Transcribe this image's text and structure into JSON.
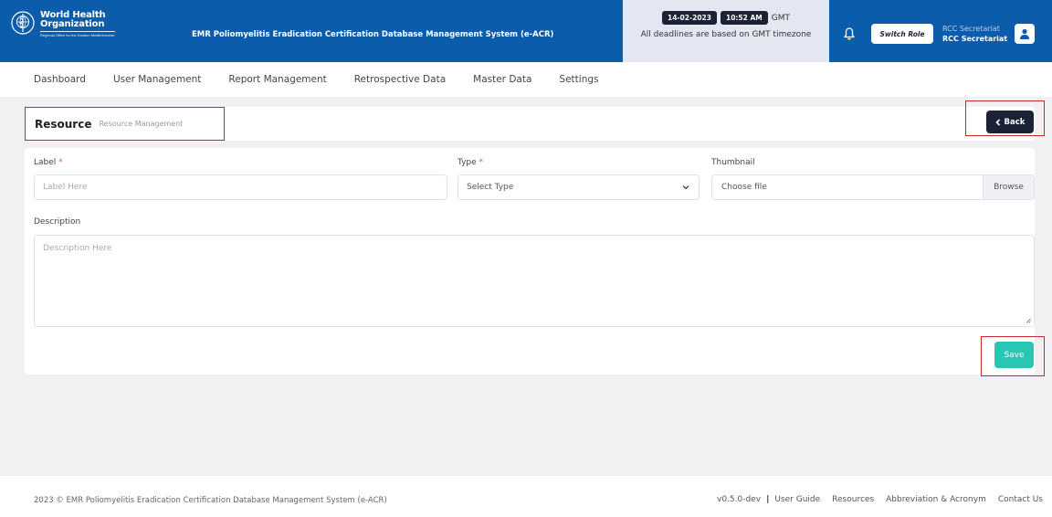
{
  "header": {
    "logo_line1": "World Health",
    "logo_line2": "Organization",
    "logo_sub": "Regional Office for the Eastern Mediterranean",
    "app_title": "EMR Poliomyelitis Eradication Certification Database Management System (e-ACR)",
    "date": "14-02-2023",
    "time": "10:52 AM",
    "timezone": "GMT",
    "deadline_note": "All deadlines are based on GMT timezone",
    "switch_role_label": "Switch Role",
    "user_role": "RCC Secretariat",
    "user_name": "RCC Secretariat",
    "bg_color": "#0b5cab"
  },
  "nav": {
    "items": [
      {
        "label": "Dashboard"
      },
      {
        "label": "User Management"
      },
      {
        "label": "Report Management"
      },
      {
        "label": "Retrospective Data"
      },
      {
        "label": "Master Data"
      },
      {
        "label": "Settings"
      }
    ]
  },
  "page": {
    "title": "Resource",
    "breadcrumb": "Resource Management",
    "back_label": "Back"
  },
  "form": {
    "label_field": {
      "label": "Label",
      "required_mark": "*",
      "placeholder": "Label Here"
    },
    "type_field": {
      "label": "Type",
      "required_mark": "*",
      "selected": "Select Type"
    },
    "thumbnail_field": {
      "label": "Thumbnail",
      "file_text": "Choose file",
      "browse_label": "Browse"
    },
    "description_field": {
      "label": "Description",
      "placeholder": "Description Here"
    },
    "save_label": "Save",
    "save_color": "#27c7b3"
  },
  "footer": {
    "copyright": "2023 © EMR Poliomyelitis Eradication Certification Database Management System (e-ACR)",
    "version": "v0.5.0-dev",
    "separator": "|",
    "links": [
      "User Guide",
      "Resources",
      "Abbreviation & Acronym",
      "Contact Us"
    ]
  }
}
